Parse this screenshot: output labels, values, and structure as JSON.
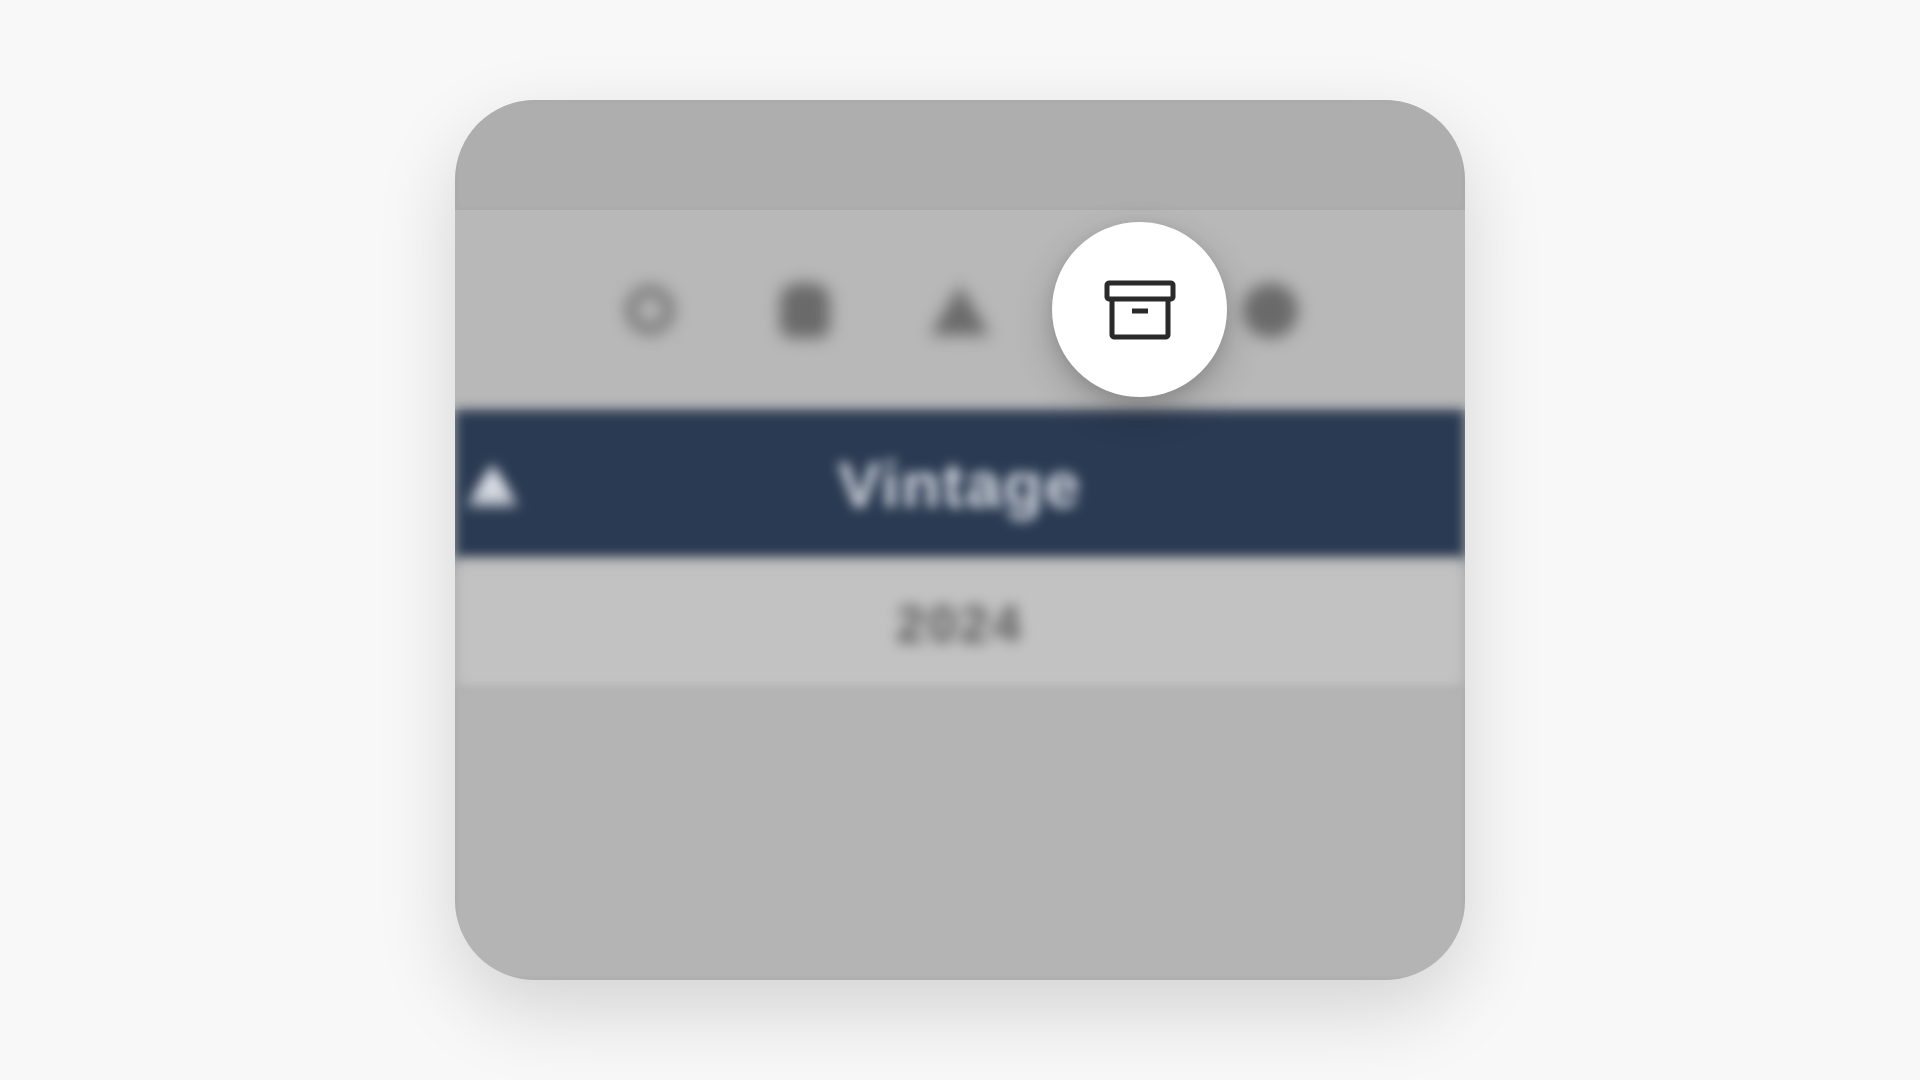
{
  "header": {
    "title": "Vintage"
  },
  "content": {
    "year": "2024"
  },
  "toolbar": {
    "icons": {
      "search": "search-icon",
      "lock": "lock-icon",
      "share": "share-icon",
      "archive": "archive-icon",
      "globe": "globe-icon"
    }
  },
  "colors": {
    "header_bg": "#2a3a52",
    "panel_bg": "#a8a8a8",
    "highlight_bg": "#ffffff"
  }
}
